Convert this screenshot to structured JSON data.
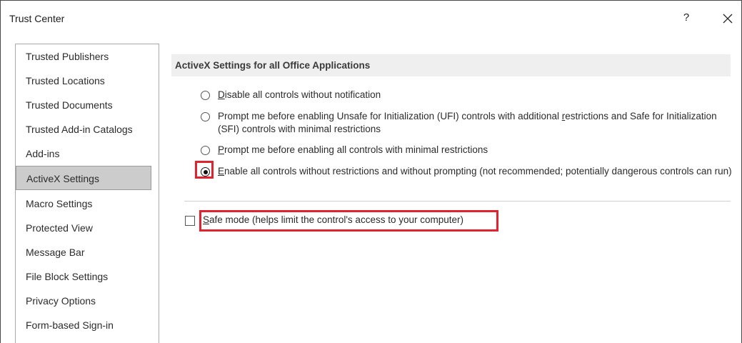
{
  "window": {
    "title": "Trust Center",
    "help_label": "?"
  },
  "sidebar": {
    "items": [
      {
        "label": "Trusted Publishers",
        "selected": false
      },
      {
        "label": "Trusted Locations",
        "selected": false
      },
      {
        "label": "Trusted Documents",
        "selected": false
      },
      {
        "label": "Trusted Add-in Catalogs",
        "selected": false
      },
      {
        "label": "Add-ins",
        "selected": false
      },
      {
        "label": "ActiveX Settings",
        "selected": true
      },
      {
        "label": "Macro Settings",
        "selected": false
      },
      {
        "label": "Protected View",
        "selected": false
      },
      {
        "label": "Message Bar",
        "selected": false
      },
      {
        "label": "File Block Settings",
        "selected": false
      },
      {
        "label": "Privacy Options",
        "selected": false
      },
      {
        "label": "Form-based Sign-in",
        "selected": false
      }
    ]
  },
  "activex": {
    "section_title": "ActiveX Settings for all Office Applications",
    "options": [
      {
        "accel": "D",
        "rest": "isable all controls without notification",
        "checked": false
      },
      {
        "pre": "Prompt me before enabling Unsafe for Initialization (UFI) controls with additional ",
        "accel": "r",
        "rest": "estrictions and Safe for Initialization (SFI) controls with minimal restrictions",
        "checked": false
      },
      {
        "accel": "P",
        "rest": "rompt me before enabling all controls with minimal restrictions",
        "checked": false
      },
      {
        "accel": "E",
        "rest": "nable all controls without restrictions and without prompting (not recommended; potentially dangerous controls can run)",
        "checked": true
      }
    ],
    "safe_mode": {
      "accel": "S",
      "rest": "afe mode (helps limit the control's access to your computer)",
      "checked": false
    }
  },
  "colors": {
    "highlight": "#e0242f",
    "selected_bg": "#cccccc",
    "section_bg": "#efefef"
  }
}
